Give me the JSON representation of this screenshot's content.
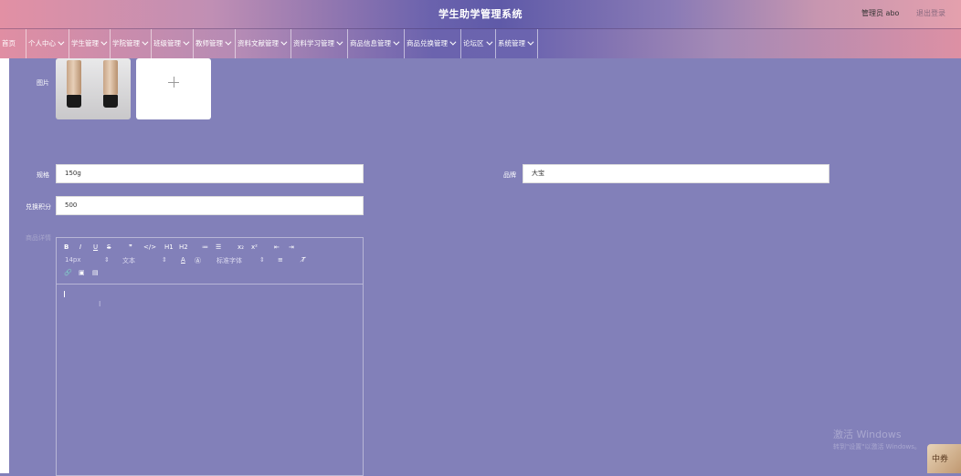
{
  "header": {
    "title": "学生助学管理系统",
    "user_label": "管理员 abo",
    "logout_label": "退出登录"
  },
  "nav": {
    "items": [
      {
        "label": "首页",
        "has_dropdown": false
      },
      {
        "label": "个人中心",
        "has_dropdown": true
      },
      {
        "label": "学生管理",
        "has_dropdown": true
      },
      {
        "label": "学院管理",
        "has_dropdown": true
      },
      {
        "label": "班级管理",
        "has_dropdown": true
      },
      {
        "label": "教师管理",
        "has_dropdown": true
      },
      {
        "label": "资料文献管理",
        "has_dropdown": true
      },
      {
        "label": "资料学习管理",
        "has_dropdown": true
      },
      {
        "label": "商品信息管理",
        "has_dropdown": true
      },
      {
        "label": "商品兑换管理",
        "has_dropdown": true
      },
      {
        "label": "论坛区",
        "has_dropdown": true
      },
      {
        "label": "系统管理",
        "has_dropdown": true
      }
    ]
  },
  "form": {
    "image_label": "图片",
    "spec_label": "规格",
    "spec_value": "150g",
    "brand_label": "品牌",
    "brand_value": "大宝",
    "points_label": "兑换积分",
    "points_value": "500",
    "detail_label": "商品详情"
  },
  "editor": {
    "toolbar_row1": [
      "B",
      "I",
      "U",
      "S",
      "❞",
      "</>",
      "H1",
      "H2",
      "≔",
      "☰",
      "x₂",
      "x²",
      "⇤",
      "⇥"
    ],
    "font_size": "14px",
    "text_style": "文本",
    "font_family": "标准字体"
  },
  "watermark": {
    "line1": "激活 Windows",
    "line2": "转到\"设置\"以激活 Windows。"
  },
  "avatar_text": "中券"
}
